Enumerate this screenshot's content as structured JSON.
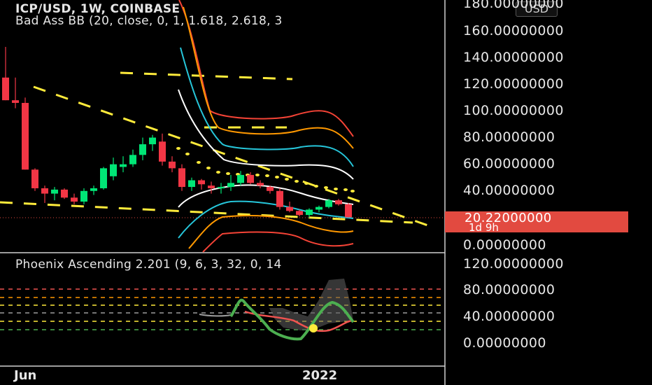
{
  "header": {
    "symbol_line": "ICP/USD, 1W, COINBASE",
    "indicator_line": "Bad Ass BB (20, close, 0, 1, 1.618, 2.618, 3",
    "oscillator_line": "Phoenix Ascending 2.201 (9, 6, 3, 32, 0, 14"
  },
  "currency_button": "USD",
  "price_axis": [
    "180.00000000",
    "160.00000000",
    "140.00000000",
    "120.00000000",
    "100.00000000",
    "80.00000000",
    "60.00000000",
    "40.00000000",
    "0.00000000"
  ],
  "oscillator_axis": [
    "120.00000000",
    "80.00000000",
    "40.00000000",
    "0.00000000"
  ],
  "last_price": {
    "value": "20.22000000",
    "countdown": "1d 9h"
  },
  "time_axis": [
    "Jun",
    "2022"
  ],
  "colors": {
    "up": "#00e676",
    "down": "#f23645",
    "price_tag": "#e24a40",
    "trend": "#ffeb3b",
    "bb_outer": "#f44336",
    "bb_mid": "#ff9800",
    "bb_inner": "#26c6da",
    "bb_core": "#ffffff",
    "osc_green": "#4caf50",
    "osc_red": "#ef5350"
  },
  "chart_data": {
    "type": "candlestick",
    "y_range": [
      0,
      180
    ],
    "candles": [
      {
        "o": 125,
        "h": 148,
        "l": 108,
        "c": 108
      },
      {
        "o": 108,
        "h": 125,
        "l": 102,
        "c": 106
      },
      {
        "o": 106,
        "h": 110,
        "l": 56,
        "c": 56
      },
      {
        "o": 56,
        "h": 57,
        "l": 40,
        "c": 42
      },
      {
        "o": 42,
        "h": 44,
        "l": 31,
        "c": 38
      },
      {
        "o": 38,
        "h": 43,
        "l": 33,
        "c": 41
      },
      {
        "o": 41,
        "h": 42,
        "l": 34,
        "c": 35
      },
      {
        "o": 35,
        "h": 38,
        "l": 30,
        "c": 32
      },
      {
        "o": 32,
        "h": 42,
        "l": 30,
        "c": 40
      },
      {
        "o": 40,
        "h": 44,
        "l": 37,
        "c": 42
      },
      {
        "o": 42,
        "h": 58,
        "l": 41,
        "c": 57
      },
      {
        "o": 51,
        "h": 65,
        "l": 48,
        "c": 60
      },
      {
        "o": 58,
        "h": 66,
        "l": 54,
        "c": 60
      },
      {
        "o": 60,
        "h": 71,
        "l": 58,
        "c": 67
      },
      {
        "o": 67,
        "h": 80,
        "l": 63,
        "c": 75
      },
      {
        "o": 75,
        "h": 82,
        "l": 70,
        "c": 80
      },
      {
        "o": 77,
        "h": 83,
        "l": 59,
        "c": 62
      },
      {
        "o": 62,
        "h": 66,
        "l": 54,
        "c": 57
      },
      {
        "o": 57,
        "h": 60,
        "l": 40,
        "c": 43
      },
      {
        "o": 43,
        "h": 50,
        "l": 40,
        "c": 48
      },
      {
        "o": 48,
        "h": 49,
        "l": 41,
        "c": 45
      },
      {
        "o": 44,
        "h": 47,
        "l": 38,
        "c": 42
      },
      {
        "o": 42,
        "h": 46,
        "l": 38,
        "c": 43
      },
      {
        "o": 43,
        "h": 52,
        "l": 40,
        "c": 46
      },
      {
        "o": 46,
        "h": 55,
        "l": 44,
        "c": 52
      },
      {
        "o": 52,
        "h": 54,
        "l": 45,
        "c": 46
      },
      {
        "o": 46,
        "h": 48,
        "l": 42,
        "c": 44
      },
      {
        "o": 43,
        "h": 44,
        "l": 38,
        "c": 40
      },
      {
        "o": 40,
        "h": 42,
        "l": 26,
        "c": 28
      },
      {
        "o": 28,
        "h": 32,
        "l": 24,
        "c": 25
      },
      {
        "o": 25,
        "h": 26,
        "l": 21,
        "c": 22
      },
      {
        "o": 22,
        "h": 27,
        "l": 20,
        "c": 26
      },
      {
        "o": 26,
        "h": 29,
        "l": 24,
        "c": 28
      },
      {
        "o": 28,
        "h": 34,
        "l": 27,
        "c": 33
      },
      {
        "o": 33,
        "h": 34,
        "l": 29,
        "c": 30
      },
      {
        "o": 30,
        "h": 31,
        "l": 20,
        "c": 20.22
      }
    ]
  }
}
